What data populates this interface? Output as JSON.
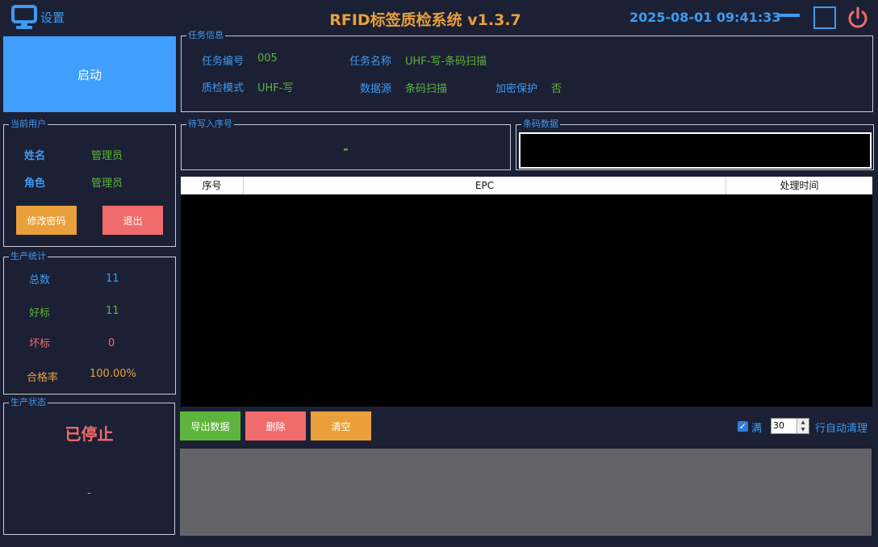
{
  "header": {
    "settings_label": "设置",
    "title": "RFID标签质检系统 v1.3.7",
    "datetime": "2025-08-01 09:41:33"
  },
  "colors": {
    "background": "#1c2035",
    "accent_blue": "#3d9bf0",
    "green": "#5cb53a",
    "orange": "#e9a03a",
    "red": "#f06b6b",
    "start_button": "#409eff"
  },
  "start_button": {
    "label": "启动"
  },
  "task_info": {
    "legend": "任务信息",
    "task_no_label": "任务编号",
    "task_no": "005",
    "task_name_label": "任务名称",
    "task_name": "UHF-写-条码扫描",
    "mode_label": "质检模式",
    "mode": "UHF-写",
    "source_label": "数据源",
    "source": "条码扫描",
    "encrypt_label": "加密保护",
    "encrypt": "否"
  },
  "current_user": {
    "legend": "当前用户",
    "name_label": "姓名",
    "name": "管理员",
    "role_label": "角色",
    "role": "管理员",
    "change_password": "修改密码",
    "logout": "退出"
  },
  "stats": {
    "legend": "生产统计",
    "total_label": "总数",
    "total": "11",
    "good_label": "好标",
    "good": "11",
    "bad_label": "坏标",
    "bad": "0",
    "rate_label": "合格率",
    "rate": "100.00%"
  },
  "status": {
    "legend": "生产状态",
    "state": "已停止",
    "detail": "-"
  },
  "pending": {
    "legend": "待写入序号",
    "value": "-"
  },
  "barcode": {
    "legend": "条码数据",
    "value": ""
  },
  "table": {
    "headers": [
      "序号",
      "EPC",
      "处理时间"
    ],
    "rows": []
  },
  "actions": {
    "export": "导出数据",
    "delete": "删除",
    "clear": "清空"
  },
  "auto_clear": {
    "checked": true,
    "prefix": "满",
    "count": "30",
    "suffix": "行自动清理"
  },
  "log": {
    "text": ""
  }
}
